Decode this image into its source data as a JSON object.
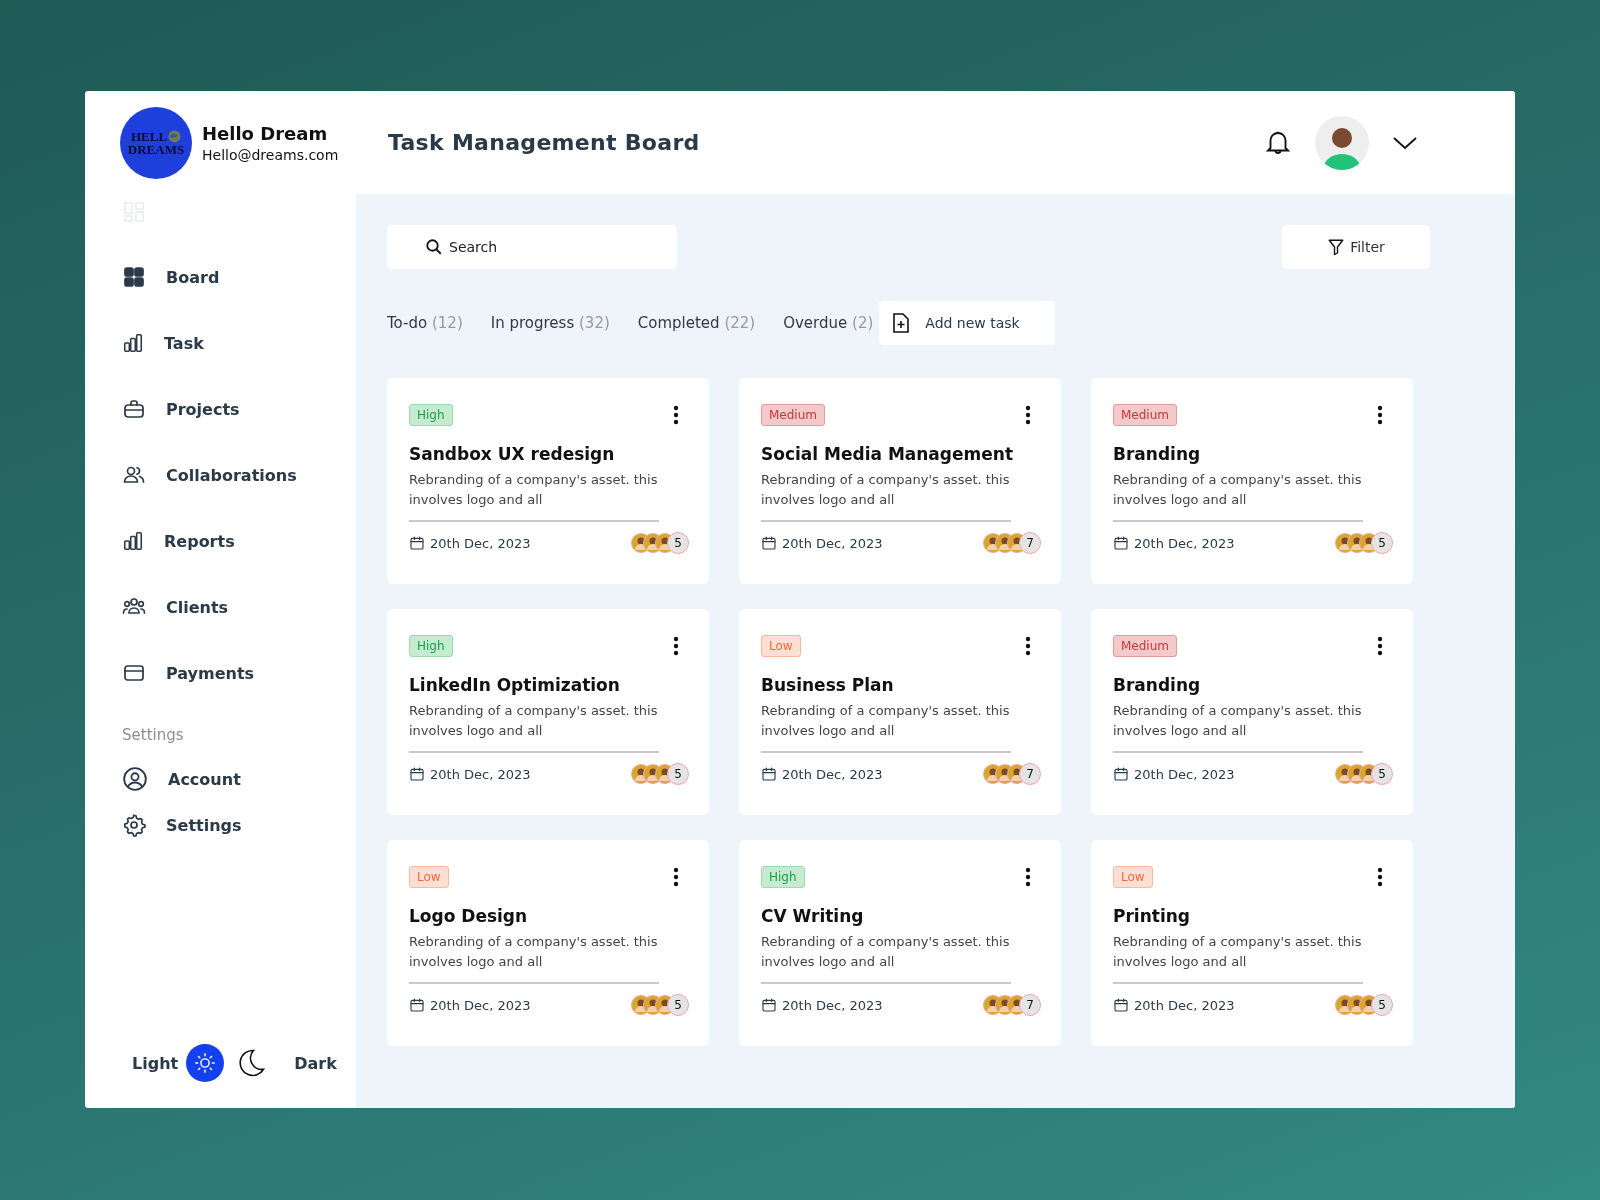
{
  "profile": {
    "logo_text": [
      "HELL",
      "DREAMS"
    ],
    "name": "Hello Dream",
    "email": "Hello@dreams.com"
  },
  "header": {
    "title": "Task Management Board"
  },
  "sidebar": {
    "items": [
      {
        "label": "Board",
        "selected": false
      },
      {
        "label": "Task",
        "selected": false
      },
      {
        "label": "Projects",
        "selected": false
      },
      {
        "label": "Collaborations",
        "selected": false
      },
      {
        "label": "Reports",
        "selected": false
      },
      {
        "label": "Clients",
        "selected": false
      },
      {
        "label": "Payments",
        "selected": false
      }
    ],
    "settings_heading": "Settings",
    "settings_items": [
      {
        "label": "Account",
        "selected": false
      },
      {
        "label": "Settings",
        "selected": false
      }
    ],
    "theme": [
      {
        "label": "Light",
        "selected": true
      },
      {
        "label": "Dark",
        "selected": false
      }
    ]
  },
  "search": {
    "placeholder": "Search"
  },
  "filter": {
    "label": "Filter"
  },
  "tabs": [
    {
      "label": "To-do",
      "count": "(12)",
      "selected": false
    },
    {
      "label": "In progress",
      "count": "(32)",
      "selected": false
    },
    {
      "label": "Completed",
      "count": "(22)",
      "selected": false
    },
    {
      "label": "Overdue",
      "count": "(2)",
      "selected": false
    }
  ],
  "add_task": {
    "label": "Add new task"
  },
  "cards": [
    {
      "priority": "High",
      "kind": "high",
      "title": "Sandbox UX redesign",
      "description": "Rebranding of a company's asset. this involves logo and all",
      "date": "20th Dec, 2023",
      "members": "5"
    },
    {
      "priority": "Medium",
      "kind": "medium",
      "title": "Social Media Management",
      "description": "Rebranding of a company's asset. this involves logo and all",
      "date": "20th Dec, 2023",
      "members": "7"
    },
    {
      "priority": "Medium",
      "kind": "medium",
      "title": "Branding",
      "description": "Rebranding of a company's asset. this involves logo and all",
      "date": "20th Dec, 2023",
      "members": "5"
    },
    {
      "priority": "High",
      "kind": "high",
      "title": "LinkedIn Optimization",
      "description": "Rebranding of a company's asset. this involves logo and all",
      "date": "20th Dec, 2023",
      "members": "5"
    },
    {
      "priority": "Low",
      "kind": "low",
      "title": "Business Plan",
      "description": "Rebranding of a company's asset. this involves logo and all",
      "date": "20th Dec, 2023",
      "members": "7"
    },
    {
      "priority": "Medium",
      "kind": "medium",
      "title": "Branding",
      "description": "Rebranding of a company's asset. this involves logo and all",
      "date": "20th Dec, 2023",
      "members": "5"
    },
    {
      "priority": "Low",
      "kind": "low",
      "title": "Logo Design",
      "description": "Rebranding of a company's asset. this involves logo and all",
      "date": "20th Dec, 2023",
      "members": "5"
    },
    {
      "priority": "High",
      "kind": "high",
      "title": "CV Writing",
      "description": "Rebranding of a company's asset. this involves logo and all",
      "date": "20th Dec, 2023",
      "members": "7"
    },
    {
      "priority": "Low",
      "kind": "low",
      "title": "Printing",
      "description": "Rebranding of a company's asset. this involves logo and all",
      "date": "20th Dec, 2023",
      "members": "5"
    }
  ]
}
